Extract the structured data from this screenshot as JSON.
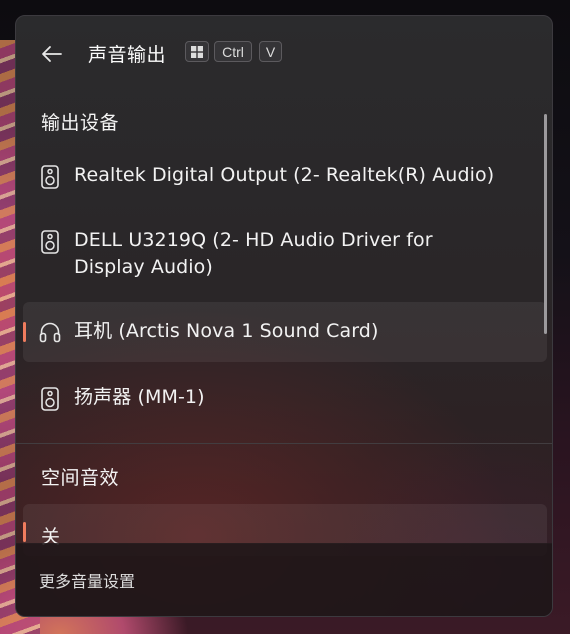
{
  "header": {
    "title": "声音输出",
    "back_icon": "arrow-left-icon",
    "shortcut_keys": [
      "Ctrl",
      "V"
    ],
    "windows_key_icon": "windows-logo-icon"
  },
  "output_devices": {
    "label": "输出设备",
    "items": [
      {
        "label": "Realtek Digital Output (2- Realtek(R) Audio)",
        "icon": "speaker-icon",
        "selected": false
      },
      {
        "label": "DELL U3219Q (2- HD Audio Driver for Display Audio)",
        "icon": "speaker-icon",
        "selected": false
      },
      {
        "label": "耳机 (Arctis Nova 1 Sound Card)",
        "icon": "headphones-icon",
        "selected": true
      },
      {
        "label": "扬声器 (MM-1)",
        "icon": "speaker-icon",
        "selected": false
      }
    ]
  },
  "spatial_audio": {
    "label": "空间音效",
    "selected_value": "关"
  },
  "footer": {
    "more_settings": "更多音量设置"
  },
  "colors": {
    "accent": "#ef7c5e",
    "panel_bg": "#2b2b2d",
    "text": "#f1f1f1"
  }
}
